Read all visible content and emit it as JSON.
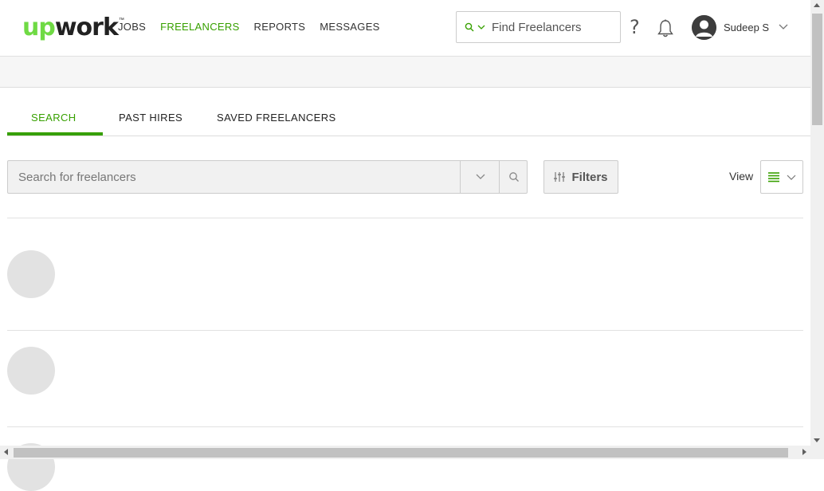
{
  "header": {
    "logo": {
      "part1": "up",
      "part2": "work",
      "tm": "™"
    },
    "nav": [
      {
        "label": "JOBS",
        "active": false
      },
      {
        "label": "FREELANCERS",
        "active": true
      },
      {
        "label": "REPORTS",
        "active": false
      },
      {
        "label": "MESSAGES",
        "active": false
      }
    ],
    "find": {
      "text": "Find Freelancers",
      "icon": "search-icon"
    },
    "help": "?",
    "user": {
      "name": "Sudeep S",
      "icon": "avatar"
    }
  },
  "tabs": [
    {
      "label": "SEARCH",
      "active": true
    },
    {
      "label": "PAST HIRES",
      "active": false
    },
    {
      "label": "SAVED FREELANCERS",
      "active": false
    }
  ],
  "search": {
    "placeholder": "Search for freelancers",
    "filters_label": "Filters",
    "view_label": "View"
  },
  "colors": {
    "accent": "#37a000",
    "logo_green": "#6fda44",
    "placeholder_grey": "#e2e2e2"
  }
}
